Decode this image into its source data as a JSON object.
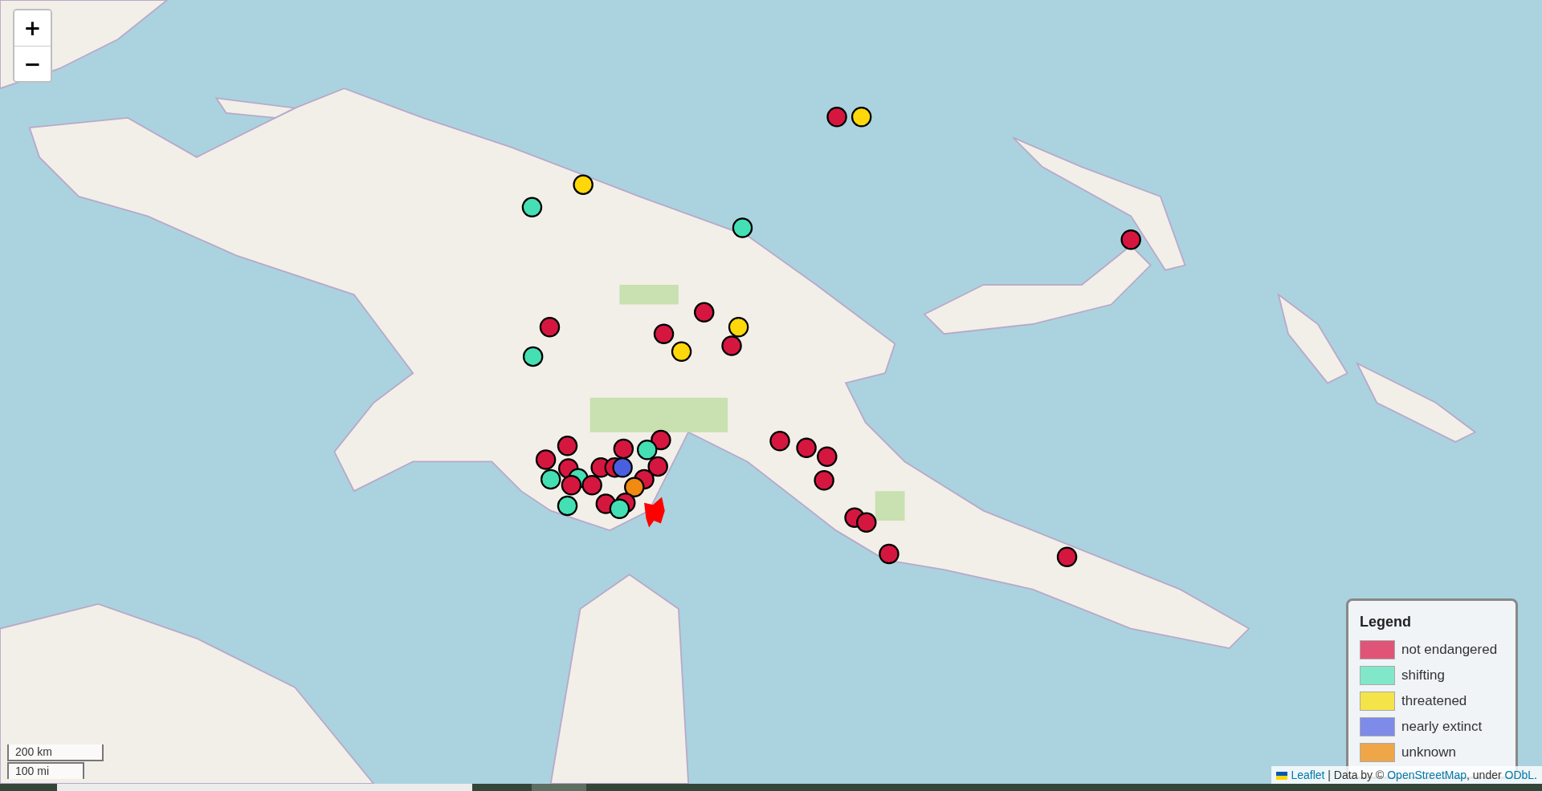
{
  "zoom_controls": [
    {
      "label": "+"
    },
    {
      "label": "−"
    }
  ],
  "markers": [
    {
      "color": "#d5173f"
    },
    {
      "color": "#ffd70a"
    },
    {
      "color": "#ffd70a"
    },
    {
      "color": "#44e0b4"
    },
    {
      "color": "#44e0b4"
    },
    {
      "color": "#d5173f"
    },
    {
      "color": "#d5173f"
    },
    {
      "color": "#d5173f"
    },
    {
      "color": "#ffd70a"
    },
    {
      "color": "#d5173f"
    },
    {
      "color": "#d5173f"
    },
    {
      "color": "#ffd70a"
    },
    {
      "color": "#44e0b4"
    },
    {
      "color": "#d5173f"
    },
    {
      "color": "#d5173f"
    },
    {
      "color": "#d5173f"
    },
    {
      "color": "#d5173f"
    },
    {
      "color": "#d5173f"
    },
    {
      "color": "#d5173f"
    },
    {
      "color": "#44e0b4"
    },
    {
      "color": "#d5173f"
    },
    {
      "color": "#d5173f"
    },
    {
      "color": "#d5173f"
    },
    {
      "color": "#d5173f"
    },
    {
      "color": "#d5173f"
    },
    {
      "color": "#4a5ee0"
    },
    {
      "color": "#d5173f"
    },
    {
      "color": "#44e0b4"
    },
    {
      "color": "#44e0b4"
    },
    {
      "color": "#d5173f"
    },
    {
      "color": "#d5173f"
    },
    {
      "color": "#d5173f"
    },
    {
      "color": "#f08a10"
    },
    {
      "color": "#d5173f"
    },
    {
      "color": "#d5173f"
    },
    {
      "color": "#44e0b4"
    },
    {
      "color": "#44e0b4"
    },
    {
      "color": "#d5173f"
    },
    {
      "color": "#d5173f"
    },
    {
      "color": "#d5173f"
    },
    {
      "color": "#d5173f"
    }
  ],
  "legend": {
    "title": "Legend",
    "items": [
      {
        "label": "not endangered",
        "color": "#e05577"
      },
      {
        "label": "shifting",
        "color": "#80e8c8"
      },
      {
        "label": "threatened",
        "color": "#f5e34a"
      },
      {
        "label": "nearly extinct",
        "color": "#7f8be8"
      },
      {
        "label": "unknown",
        "color": "#eea648"
      }
    ]
  },
  "scale": {
    "metric": "200 km",
    "imperial": "100 mi"
  },
  "attribution": {
    "parts": [
      {
        "kind": "link",
        "text": "Leaflet"
      },
      {
        "kind": "text",
        "text": " | Data by © "
      },
      {
        "kind": "link",
        "text": "OpenStreetMap"
      },
      {
        "kind": "text",
        "text": ", under "
      },
      {
        "kind": "link",
        "text": "ODbL"
      },
      {
        "kind": "text",
        "text": "."
      }
    ]
  }
}
